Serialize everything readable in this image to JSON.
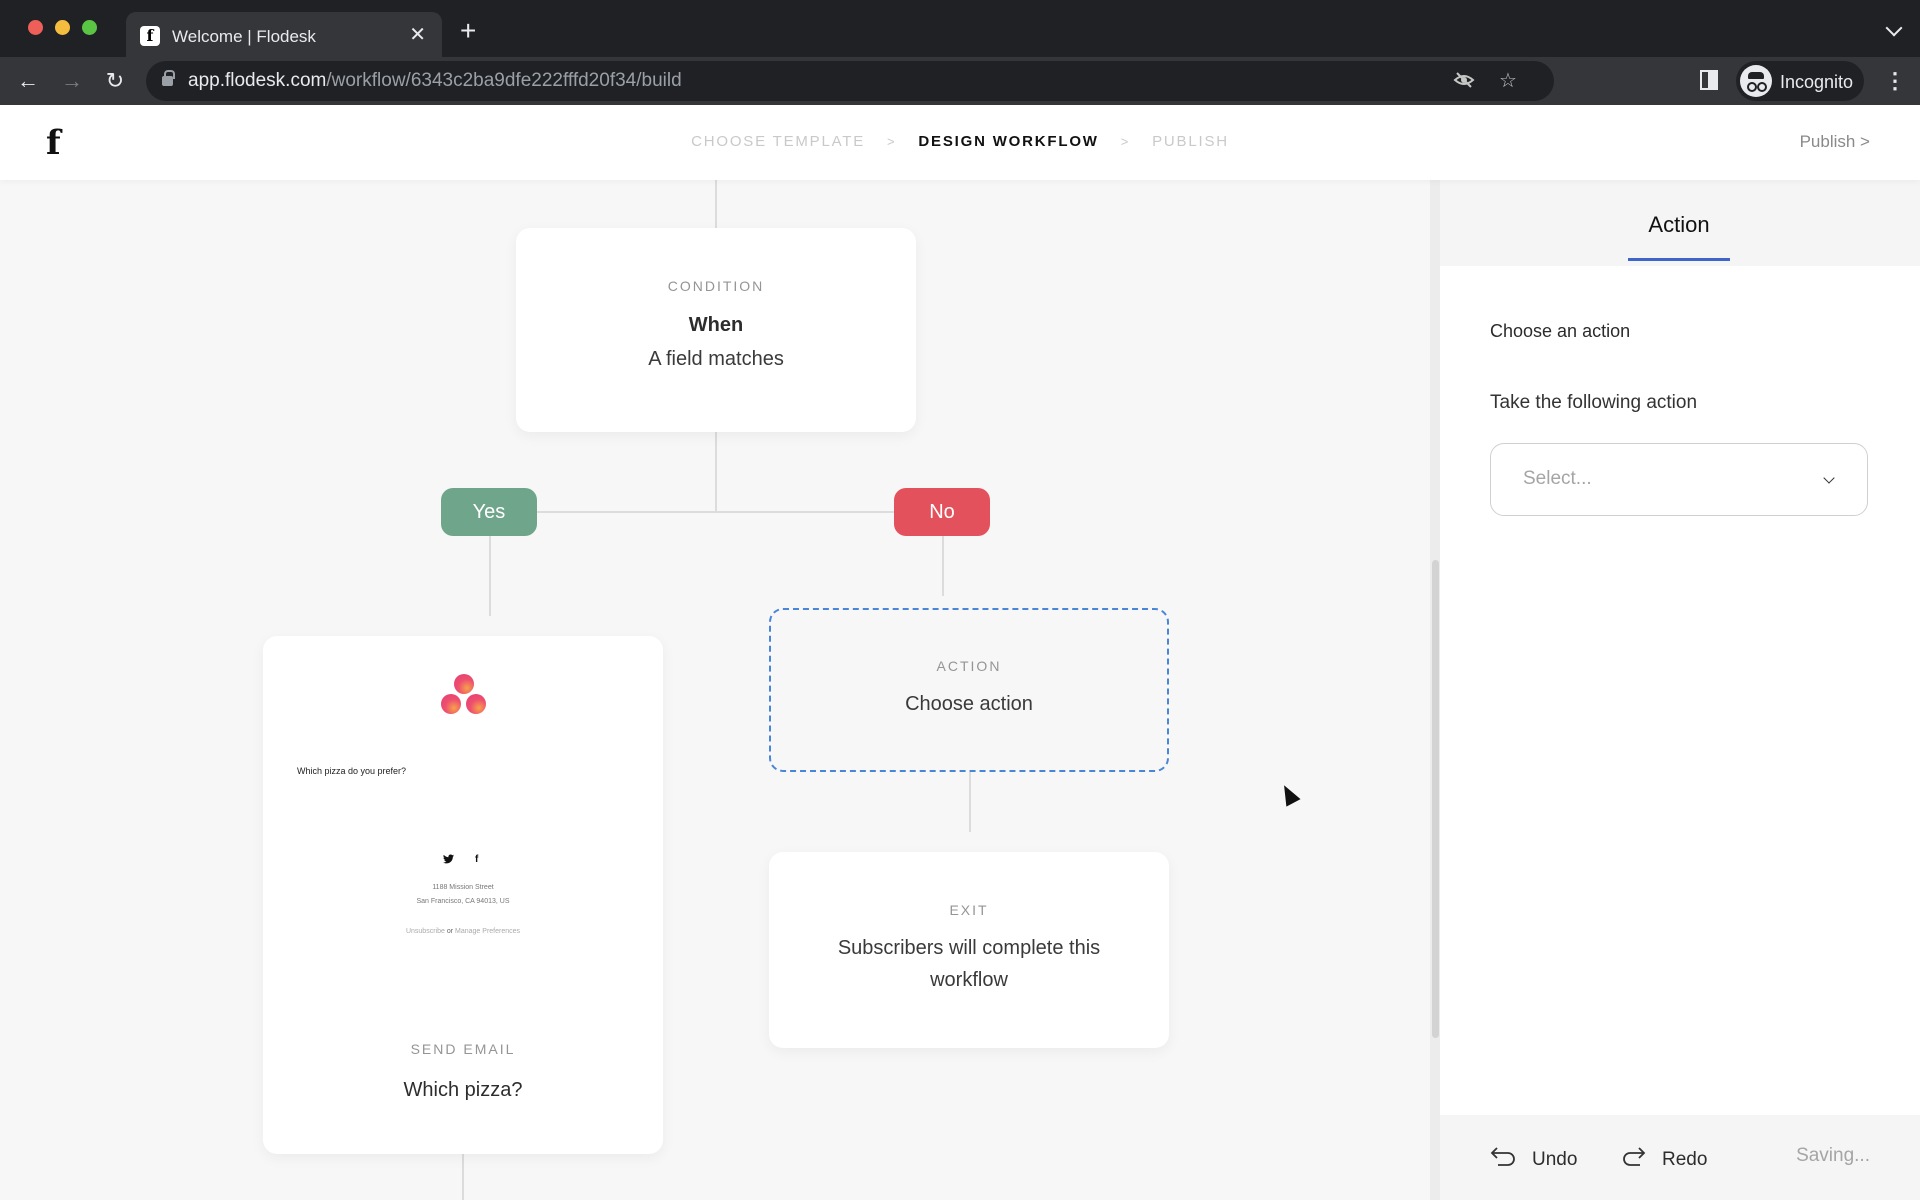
{
  "browser": {
    "tab_title": "Welcome | Flodesk",
    "url_host": "app.flodesk.com",
    "url_path": "/workflow/6343c2ba9dfe222fffd20f34/build",
    "profile_label": "Incognito",
    "icons": {
      "back": "←",
      "forward": "→",
      "reload": "↻",
      "close_tab": "✕",
      "new_tab": "+",
      "menu": "⋮",
      "eye_off": "eye-off",
      "star": "☆"
    }
  },
  "header": {
    "logo": "f",
    "steps": [
      {
        "label": "CHOOSE TEMPLATE",
        "active": false
      },
      {
        "label": "DESIGN WORKFLOW",
        "active": true
      },
      {
        "label": "PUBLISH",
        "active": false
      }
    ],
    "step_separator": ">",
    "publish_label": "Publish >"
  },
  "workflow": {
    "condition": {
      "kicker": "CONDITION",
      "title": "When",
      "subtitle": "A field matches"
    },
    "branches": {
      "yes": "Yes",
      "no": "No"
    },
    "send_email": {
      "kicker": "SEND EMAIL",
      "title": "Which pizza?",
      "preview": {
        "question": "Which pizza do you prefer?",
        "social": [
          "twitter",
          "facebook"
        ],
        "address_line1": "1188 Mission Street",
        "address_line2": "San Francisco, CA 94013, US",
        "unsubscribe": "Unsubscribe",
        "or": "or",
        "manage": "Manage Preferences"
      }
    },
    "action": {
      "kicker": "ACTION",
      "title": "Choose action"
    },
    "exit": {
      "kicker": "EXIT",
      "title": "Subscribers will complete this workflow"
    }
  },
  "panel": {
    "tab_label": "Action",
    "heading": "Choose an action",
    "field_label": "Take the following action",
    "select_placeholder": "Select...",
    "undo_label": "Undo",
    "redo_label": "Redo",
    "status": "Saving..."
  },
  "colors": {
    "yes_branch": "#6fa58a",
    "no_branch": "#e3515c",
    "selected_outline": "#4a86d8",
    "tab_underline": "#3f66c7"
  }
}
